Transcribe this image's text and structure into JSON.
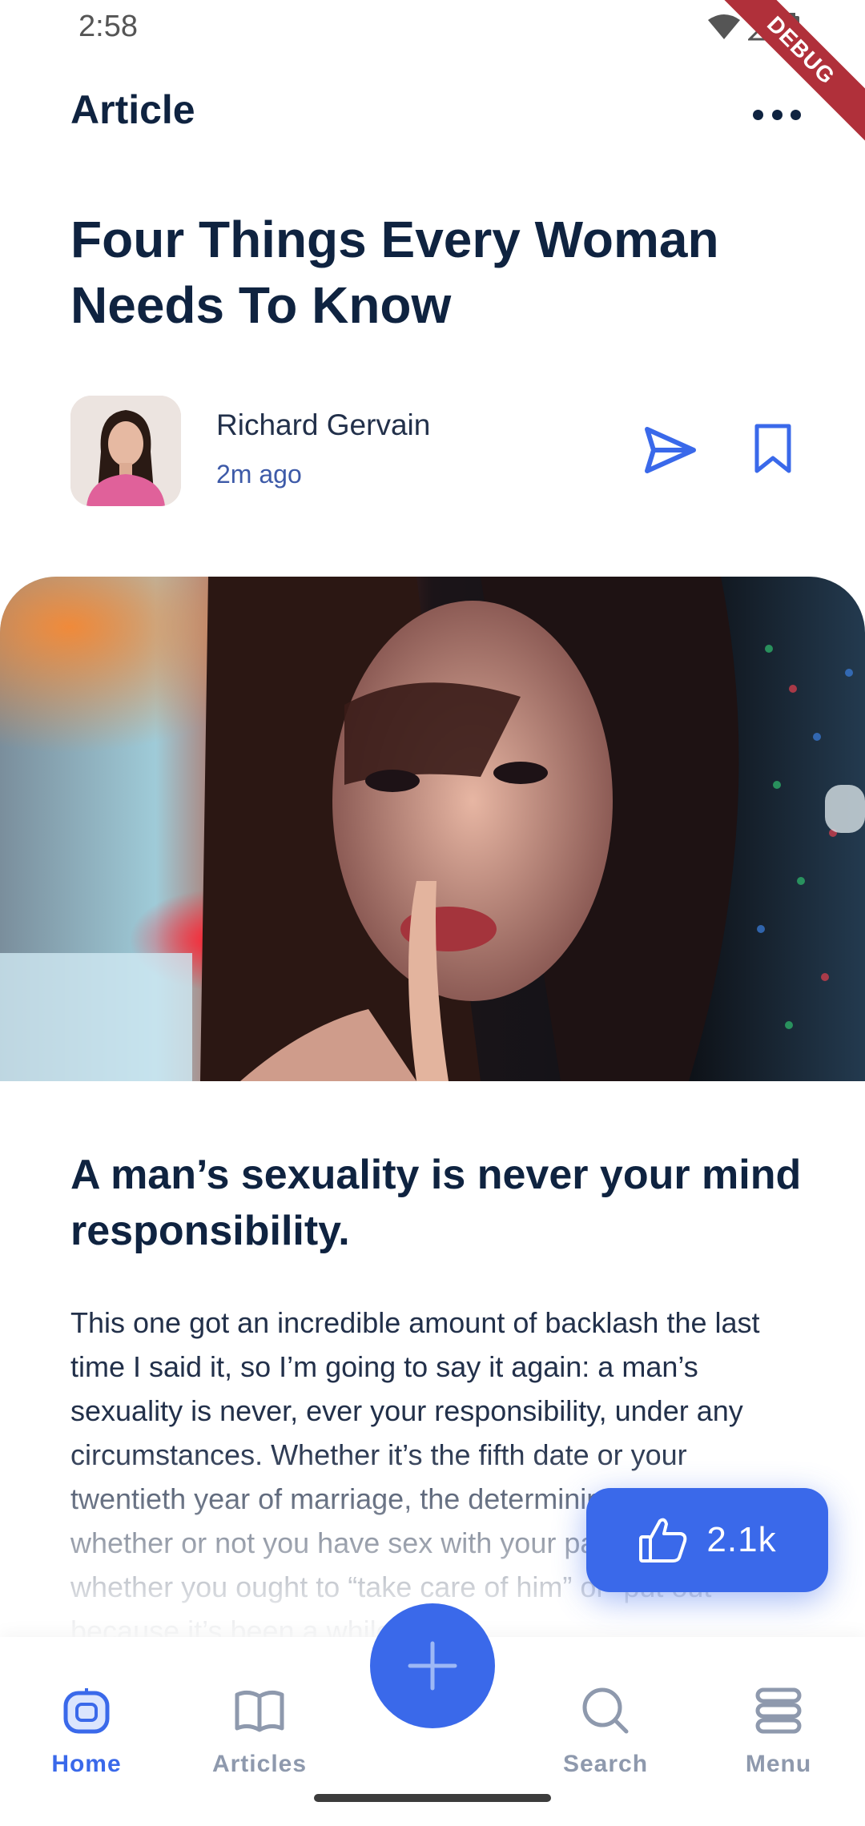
{
  "status_bar": {
    "time": "2:58",
    "debug_label": "DEBUG"
  },
  "app_bar": {
    "title": "Article"
  },
  "article": {
    "headline": "Four Things Every Woman Needs To Know",
    "author": {
      "name": "Richard Gervain",
      "time_ago": "2m ago"
    },
    "section_heading": "A man’s sexuality is never your mind responsibility.",
    "body": "This one got an incredible amount of backlash the last time I said it, so I’m going to say it again: a man’s sexuality is never, ever your responsibility, under any circumstances. Whether it’s the fifth date or your twentieth year of marriage, the determining factor for whether or not you have sex with your partner isn’t whether you ought to “take care of him” or “put out” because it’s been a while"
  },
  "like": {
    "count": "2.1k"
  },
  "bottom_nav": {
    "items": [
      {
        "label": "Home",
        "icon": "home-icon",
        "active": true
      },
      {
        "label": "Articles",
        "icon": "book-icon",
        "active": false
      },
      {
        "label": "Search",
        "icon": "search-icon",
        "active": false
      },
      {
        "label": "Menu",
        "icon": "menu-icon",
        "active": false
      }
    ]
  },
  "colors": {
    "accent": "#3a69ea",
    "text_dark": "#0f2340",
    "nav_inactive": "#8e99ad",
    "debug_banner": "#b0303a"
  }
}
